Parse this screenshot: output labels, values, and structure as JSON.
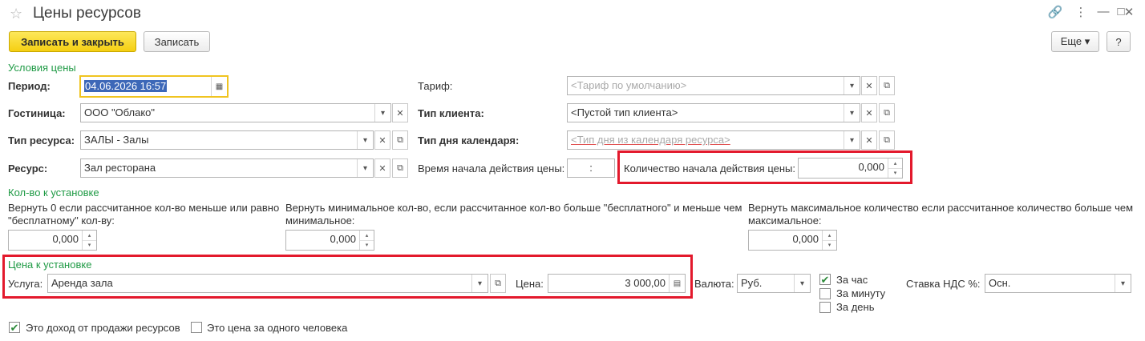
{
  "window": {
    "title": "Цены ресурсов",
    "star_icon": "☆",
    "link_icon": "🔗",
    "menu_icon": "⋮",
    "minimize_icon": "—",
    "maximize_icon": "□",
    "close_icon": "✕"
  },
  "toolbar": {
    "save_close_label": "Записать и закрыть",
    "save_label": "Записать",
    "more_label": "Еще ▾",
    "help_label": "?"
  },
  "conditions": {
    "section_label": "Условия цены",
    "period_label": "Период:",
    "period_value": "04.06.2026 16:57",
    "hotel_label": "Гостиница:",
    "hotel_value": "ООО \"Облако\"",
    "resource_type_label": "Тип ресурса:",
    "resource_type_value": "ЗАЛЫ - Залы",
    "resource_label": "Ресурс:",
    "resource_value": "Зал ресторана",
    "tariff_label": "Тариф:",
    "tariff_placeholder": "<Тариф по умолчанию>",
    "client_type_label": "Тип клиента:",
    "client_type_value": "<Пустой тип клиента>",
    "day_type_label": "Тип дня календаря:",
    "day_type_placeholder": "<Тип дня из календаря ресурса>",
    "start_time_label": "Время начала действия цены:",
    "start_time_value": ":",
    "start_qty_label": "Количество начала действия цены:",
    "start_qty_value": "0,000"
  },
  "quantity": {
    "section_label": "Кол-во к установке",
    "col1_desc": "Вернуть 0 если рассчитанное кол-во меньше или равно \"бесплатному\" кол-ву:",
    "col1_value": "0,000",
    "col2_desc": "Вернуть минимальное кол-во, если рассчитанное кол-во больше \"бесплатного\" и меньше чем минимальное:",
    "col2_value": "0,000",
    "col3_desc": "Вернуть максимальное количество если рассчитанное количество больше чем максимальное:",
    "col3_value": "0,000"
  },
  "price": {
    "section_label": "Цена к установке",
    "service_label": "Услуга:",
    "service_value": "Аренда зала",
    "price_label": "Цена:",
    "price_value": "3 000,00",
    "currency_label": "Валюта:",
    "currency_value": "Руб.",
    "per_hour_label": "За час",
    "per_minute_label": "За минуту",
    "per_day_label": "За день",
    "vat_label": "Ставка НДС %:",
    "vat_value": "Осн."
  },
  "footer": {
    "income_label": "Это доход от продажи ресурсов",
    "per_person_label": "Это цена за одного человека"
  },
  "icons": {
    "dropdown": "▾",
    "clear": "✕",
    "open": "⧉",
    "calendar": "▦",
    "calculator": "▤",
    "spin_up": "▴",
    "spin_down": "▾",
    "check": "✔"
  },
  "states": {
    "per_hour_checked": true,
    "per_minute_checked": false,
    "per_day_checked": false,
    "income_checked": true,
    "per_person_checked": false
  },
  "colors": {
    "primary_button": "#f5cf12",
    "section_green": "#1f9a45",
    "highlight_red": "#e3192c",
    "focus_yellow": "#f0c420",
    "selection_blue": "#3d68b8"
  }
}
